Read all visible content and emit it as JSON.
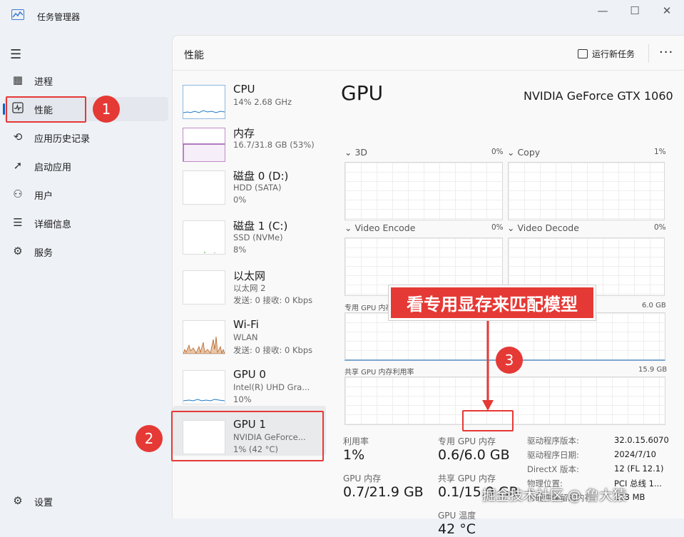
{
  "window": {
    "title": "任务管理器",
    "minimize": "—",
    "maximize": "☐",
    "close": "✕"
  },
  "nav": {
    "items": [
      {
        "label": "进程",
        "icon": "processes-icon"
      },
      {
        "label": "性能",
        "icon": "performance-icon"
      },
      {
        "label": "应用历史记录",
        "icon": "app-history-icon"
      },
      {
        "label": "启动应用",
        "icon": "startup-icon"
      },
      {
        "label": "用户",
        "icon": "users-icon"
      },
      {
        "label": "详细信息",
        "icon": "details-icon"
      },
      {
        "label": "服务",
        "icon": "services-icon"
      }
    ],
    "settings": "设置"
  },
  "header": {
    "title": "性能",
    "run_new_task": "运行新任务",
    "more": "···"
  },
  "devices": [
    {
      "name": "CPU",
      "sub1": "14% 2.68 GHz",
      "sub2": ""
    },
    {
      "name": "内存",
      "sub1": "16.7/31.8 GB (53%)",
      "sub2": ""
    },
    {
      "name": "磁盘 0 (D:)",
      "sub1": "HDD (SATA)",
      "sub2": "0%"
    },
    {
      "name": "磁盘 1 (C:)",
      "sub1": "SSD (NVMe)",
      "sub2": "8%"
    },
    {
      "name": "以太网",
      "sub1": "以太网 2",
      "sub2": "发送: 0 接收: 0 Kbps"
    },
    {
      "name": "Wi-Fi",
      "sub1": "WLAN",
      "sub2": "发送: 0 接收: 0 Kbps"
    },
    {
      "name": "GPU 0",
      "sub1": "Intel(R) UHD Gra...",
      "sub2": "10%"
    },
    {
      "name": "GPU 1",
      "sub1": "NVIDIA GeForce...",
      "sub2": "1% (42 °C)"
    }
  ],
  "gpu": {
    "title": "GPU",
    "model": "NVIDIA GeForce GTX 1060",
    "engines": [
      {
        "name": "3D",
        "pct": "0%"
      },
      {
        "name": "Copy",
        "pct": "1%"
      },
      {
        "name": "Video Encode",
        "pct": "0%"
      },
      {
        "name": "Video Decode",
        "pct": "0%"
      }
    ],
    "dedicated_label": "专用 GPU 内存利用率",
    "dedicated_max": "6.0 GB",
    "shared_label": "共享 GPU 内存利用率",
    "shared_max": "15.9 GB",
    "stats": {
      "util_label": "利用率",
      "util": "1%",
      "dedicated_mem_label": "专用 GPU 内存",
      "dedicated_mem_used": "0.6/",
      "dedicated_mem_total": "6.0 GB",
      "gpu_mem_label": "GPU 内存",
      "gpu_mem": "0.7/21.9 GB",
      "shared_mem_label": "共享 GPU 内存",
      "shared_mem": "0.1/15.9 GB",
      "temp_label": "GPU 温度",
      "temp": "42 °C"
    },
    "info": [
      {
        "k": "驱动程序版本:",
        "v": "32.0.15.6070"
      },
      {
        "k": "驱动程序日期:",
        "v": "2024/7/10"
      },
      {
        "k": "DirectX 版本:",
        "v": "12 (FL 12.1)"
      },
      {
        "k": "物理位置:",
        "v": "PCI 总线 1..."
      },
      {
        "k": "为硬件保留的内存:",
        "v": "113 MB"
      }
    ]
  },
  "annotations": {
    "n1": "1",
    "n2": "2",
    "n3": "3",
    "banner": "看专用显存来匹配模型",
    "color": "#e53935"
  },
  "watermark": "掘金技术社区 @ 鲁大猿"
}
